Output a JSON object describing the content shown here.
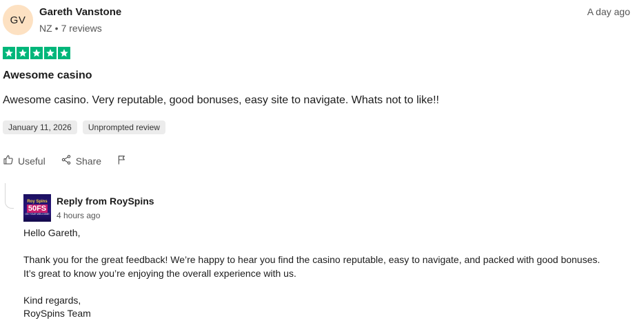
{
  "review": {
    "avatar_initials": "GV",
    "reviewer_name": "Gareth Vanstone",
    "country": "NZ",
    "separator": "•",
    "review_count": "7 reviews",
    "relative_date": "A day ago",
    "rating": 5,
    "star_color": "#00b67a",
    "title": "Awesome casino",
    "body": "Awesome casino. Very reputable, good bonuses, easy site to navigate. Whats not to like!!",
    "experience_date": "January 11, 2026",
    "label": "Unprompted review"
  },
  "actions": {
    "useful_label": "Useful",
    "share_label": "Share",
    "useful_icon": "thumbs-up-icon",
    "share_icon": "share-icon",
    "flag_icon": "flag-icon"
  },
  "reply": {
    "logo_text_top": "Roy Spins",
    "logo_text_main": "50FS",
    "logo_text_bottom": "ON YOUR WELCOME",
    "from": "Reply from RoySpins",
    "time": "4 hours ago",
    "greeting": "Hello Gareth,",
    "line1": "Thank you for the great feedback! We’re happy to hear you find the casino reputable, easy to navigate, and packed with good bonuses.",
    "line2": "It’s great to know you’re enjoying the overall experience with us.",
    "closing": "Kind regards,",
    "signature": "RoySpins Team"
  }
}
